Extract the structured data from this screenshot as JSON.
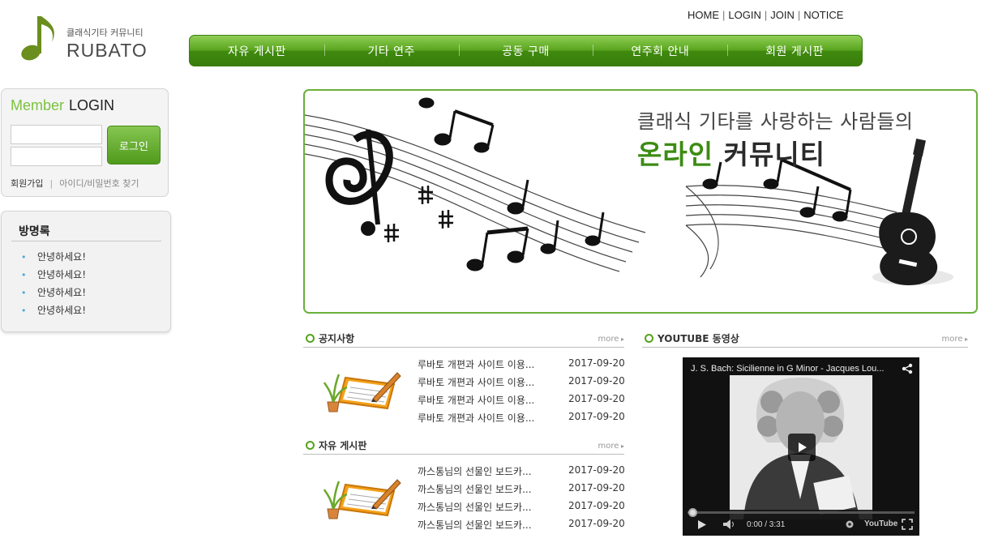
{
  "site": {
    "logo_subtitle": "클래식기타 커뮤니티",
    "logo_title": "RUBATO"
  },
  "top_links": [
    "HOME",
    "LOGIN",
    "JOIN",
    "NOTICE"
  ],
  "nav": [
    "자유 게시판",
    "기타 연주",
    "공동 구매",
    "연주회 안내",
    "회원 게시판"
  ],
  "login": {
    "title_member": "Member",
    "title_login": "LOGIN",
    "button": "로그인",
    "join_link": "회원가입",
    "find_link": "아이디/비밀번호 찾기"
  },
  "guestbook": {
    "title": "방명록",
    "items": [
      "안녕하세요!",
      "안녕하세요!",
      "안녕하세요!",
      "안녕하세요!"
    ]
  },
  "banner": {
    "line1": "클래식 기타를 사랑하는 사람들의",
    "line2_green": "온라인",
    "line2_dark": "커뮤니티"
  },
  "notice": {
    "title": "공지사항",
    "more": "more",
    "posts": [
      {
        "subject": "루바토 개편과 사이트 이용...",
        "date": "2017-09-20"
      },
      {
        "subject": "루바토 개편과 사이트 이용...",
        "date": "2017-09-20"
      },
      {
        "subject": "루바토 개편과 사이트 이용...",
        "date": "2017-09-20"
      },
      {
        "subject": "루바토 개편과 사이트 이용...",
        "date": "2017-09-20"
      }
    ]
  },
  "free_board": {
    "title": "자유 게시판",
    "more": "more",
    "posts": [
      {
        "subject": "까스통님의 선물인 보드카...",
        "date": "2017-09-20"
      },
      {
        "subject": "까스통님의 선물인 보드카...",
        "date": "2017-09-20"
      },
      {
        "subject": "까스통님의 선물인 보드카...",
        "date": "2017-09-20"
      },
      {
        "subject": "까스통님의 선물인 보드카...",
        "date": "2017-09-20"
      }
    ]
  },
  "youtube": {
    "title": "YOUTUBE 동영상",
    "more": "more",
    "video_title": "J. S. Bach: Sicilienne in G Minor - Jacques Lou...",
    "time": "0:00 / 3:31",
    "brand": "YouTube"
  },
  "colors": {
    "accent_green": "#55a31c",
    "nav_green": "#5aa51f",
    "member_green": "#7cc242"
  }
}
